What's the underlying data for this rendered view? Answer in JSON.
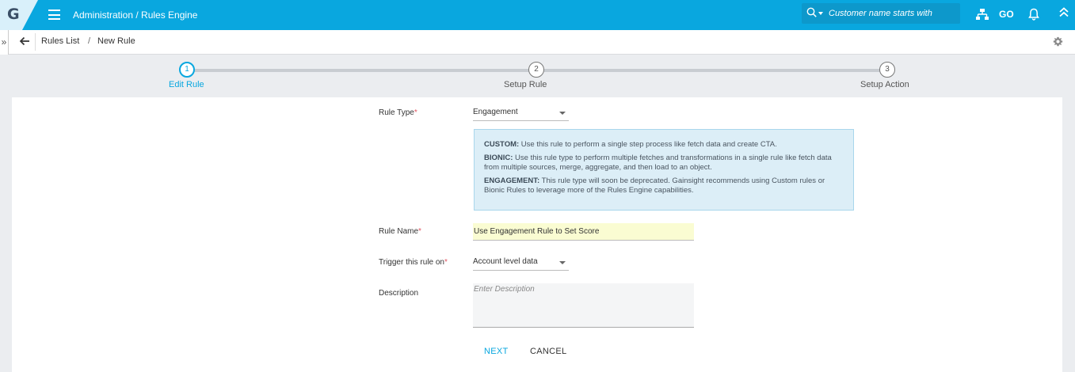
{
  "header": {
    "logo_letter": "G",
    "title": "Administration / Rules Engine",
    "search_placeholder": "Customer name starts with",
    "go_label": "GO",
    "accent_color": "#09a7df"
  },
  "breadcrumb": {
    "expander": "»",
    "items": [
      "Rules List",
      "New Rule"
    ],
    "separator": "/"
  },
  "stepper": {
    "steps": [
      {
        "number": "1",
        "label": "Edit Rule",
        "active": true
      },
      {
        "number": "2",
        "label": "Setup Rule",
        "active": false
      },
      {
        "number": "3",
        "label": "Setup Action",
        "active": false
      }
    ]
  },
  "form": {
    "rule_type": {
      "label": "Rule Type",
      "required_mark": "*",
      "value": "Engagement"
    },
    "info": {
      "custom_title": "CUSTOM:",
      "custom_text": " Use this rule to perform a single step process like fetch data and create CTA.",
      "bionic_title": "BIONIC:",
      "bionic_text": " Use this rule type to perform multiple fetches and transformations in a single rule like fetch data from multiple sources, merge, aggregate, and then load to an object.",
      "engagement_title": "ENGAGEMENT:",
      "engagement_text": " This rule type will soon be deprecated. Gainsight recommends using Custom rules or Bionic Rules to leverage more of the Rules Engine capabilities."
    },
    "rule_name": {
      "label": "Rule Name",
      "required_mark": "*",
      "value": "Use Engagement Rule to Set Score"
    },
    "trigger": {
      "label": "Trigger this rule on",
      "required_mark": "*",
      "value": "Account level data"
    },
    "description": {
      "label": "Description",
      "placeholder": "Enter Description"
    },
    "buttons": {
      "next": "NEXT",
      "cancel": "CANCEL"
    }
  }
}
